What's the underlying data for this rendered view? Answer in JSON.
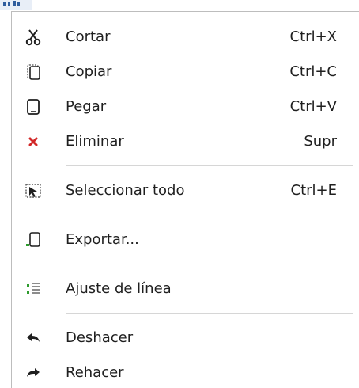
{
  "menu": {
    "items": [
      {
        "icon": "scissors-icon",
        "label": "Cortar",
        "shortcut": "Ctrl+X"
      },
      {
        "icon": "copy-icon",
        "label": "Copiar",
        "shortcut": "Ctrl+C"
      },
      {
        "icon": "paste-icon",
        "label": "Pegar",
        "shortcut": "Ctrl+V"
      },
      {
        "icon": "delete-icon",
        "label": "Eliminar",
        "shortcut": "Supr"
      },
      {
        "icon": "select-all-icon",
        "label": "Seleccionar todo",
        "shortcut": "Ctrl+E"
      },
      {
        "icon": "export-icon",
        "label": "Exportar..."
      },
      {
        "icon": "word-wrap-icon",
        "label": "Ajuste de línea"
      },
      {
        "icon": "undo-icon",
        "label": "Deshacer"
      },
      {
        "icon": "redo-icon",
        "label": "Rehacer"
      }
    ]
  },
  "colors": {
    "text": "#1f1f1f",
    "separator": "#d6d6d6",
    "delete": "#d22727",
    "export_accent": "#2e9b2e",
    "wrap_accent": "#2e9b2e"
  }
}
